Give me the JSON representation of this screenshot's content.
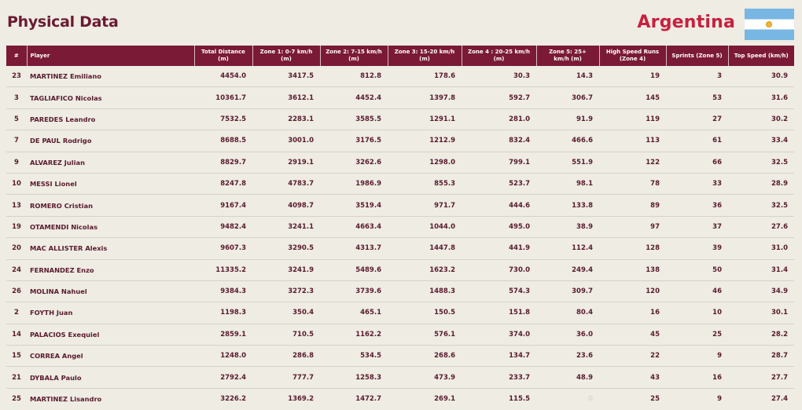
{
  "header": {
    "title": "Physical Data",
    "country": "Argentina"
  },
  "colors": {
    "maroon": "#7a1a36",
    "country_red": "#c8203f",
    "background": "#eeece3",
    "flag_blue": "#78b6e3",
    "flag_sun": "#f2b632"
  },
  "table": {
    "columns": [
      {
        "key": "num",
        "label": "#"
      },
      {
        "key": "player",
        "label": "Player"
      },
      {
        "key": "total_distance",
        "label": "Total Distance (m)"
      },
      {
        "key": "zone1",
        "label": "Zone 1: 0-7 km/h (m)"
      },
      {
        "key": "zone2",
        "label": "Zone 2: 7-15 km/h (m)"
      },
      {
        "key": "zone3",
        "label": "Zone 3: 15-20 km/h (m)"
      },
      {
        "key": "zone4",
        "label": "Zone 4 : 20-25 km/h (m)"
      },
      {
        "key": "zone5",
        "label": "Zone 5: 25+ km/h (m)"
      },
      {
        "key": "hsr",
        "label": "High Speed Runs (Zone 4)"
      },
      {
        "key": "sprints",
        "label": "Sprints (Zone 5)"
      },
      {
        "key": "top_speed",
        "label": "Top Speed (km/h)"
      }
    ],
    "rows": [
      [
        "23",
        "MARTINEZ Emiliano",
        "4454.0",
        "3417.5",
        "812.8",
        "178.6",
        "30.3",
        "14.3",
        "19",
        "3",
        "30.9"
      ],
      [
        "3",
        "TAGLIAFICO Nicolas",
        "10361.7",
        "3612.1",
        "4452.4",
        "1397.8",
        "592.7",
        "306.7",
        "145",
        "53",
        "31.6"
      ],
      [
        "5",
        "PAREDES Leandro",
        "7532.5",
        "2283.1",
        "3585.5",
        "1291.1",
        "281.0",
        "91.9",
        "119",
        "27",
        "30.2"
      ],
      [
        "7",
        "DE PAUL Rodrigo",
        "8688.5",
        "3001.0",
        "3176.5",
        "1212.9",
        "832.4",
        "466.6",
        "113",
        "61",
        "33.4"
      ],
      [
        "9",
        "ALVAREZ Julian",
        "8829.7",
        "2919.1",
        "3262.6",
        "1298.0",
        "799.1",
        "551.9",
        "122",
        "66",
        "32.5"
      ],
      [
        "10",
        "MESSI Lionel",
        "8247.8",
        "4783.7",
        "1986.9",
        "855.3",
        "523.7",
        "98.1",
        "78",
        "33",
        "28.9"
      ],
      [
        "13",
        "ROMERO Cristian",
        "9167.4",
        "4098.7",
        "3519.4",
        "971.7",
        "444.6",
        "133.8",
        "89",
        "36",
        "32.5"
      ],
      [
        "19",
        "OTAMENDI Nicolas",
        "9482.4",
        "3241.1",
        "4663.4",
        "1044.0",
        "495.0",
        "38.9",
        "97",
        "37",
        "27.6"
      ],
      [
        "20",
        "MAC ALLISTER Alexis",
        "9607.3",
        "3290.5",
        "4313.7",
        "1447.8",
        "441.9",
        "112.4",
        "128",
        "39",
        "31.0"
      ],
      [
        "24",
        "FERNANDEZ Enzo",
        "11335.2",
        "3241.9",
        "5489.6",
        "1623.2",
        "730.0",
        "249.4",
        "138",
        "50",
        "31.4"
      ],
      [
        "26",
        "MOLINA Nahuel",
        "9384.3",
        "3272.3",
        "3739.6",
        "1488.3",
        "574.3",
        "309.7",
        "120",
        "46",
        "34.9"
      ],
      [
        "2",
        "FOYTH Juan",
        "1198.3",
        "350.4",
        "465.1",
        "150.5",
        "151.8",
        "80.4",
        "16",
        "10",
        "30.1"
      ],
      [
        "14",
        "PALACIOS Exequiel",
        "2859.1",
        "710.5",
        "1162.2",
        "576.1",
        "374.0",
        "36.0",
        "45",
        "25",
        "28.2"
      ],
      [
        "15",
        "CORREA Angel",
        "1248.0",
        "286.8",
        "534.5",
        "268.6",
        "134.7",
        "23.6",
        "22",
        "9",
        "28.7"
      ],
      [
        "21",
        "DYBALA Paulo",
        "2792.4",
        "777.7",
        "1258.3",
        "473.9",
        "233.7",
        "48.9",
        "43",
        "16",
        "27.7"
      ],
      [
        "25",
        "MARTINEZ Lisandro",
        "3226.2",
        "1369.2",
        "1472.7",
        "269.1",
        "115.5",
        "0",
        "25",
        "9",
        "27.4"
      ]
    ]
  }
}
